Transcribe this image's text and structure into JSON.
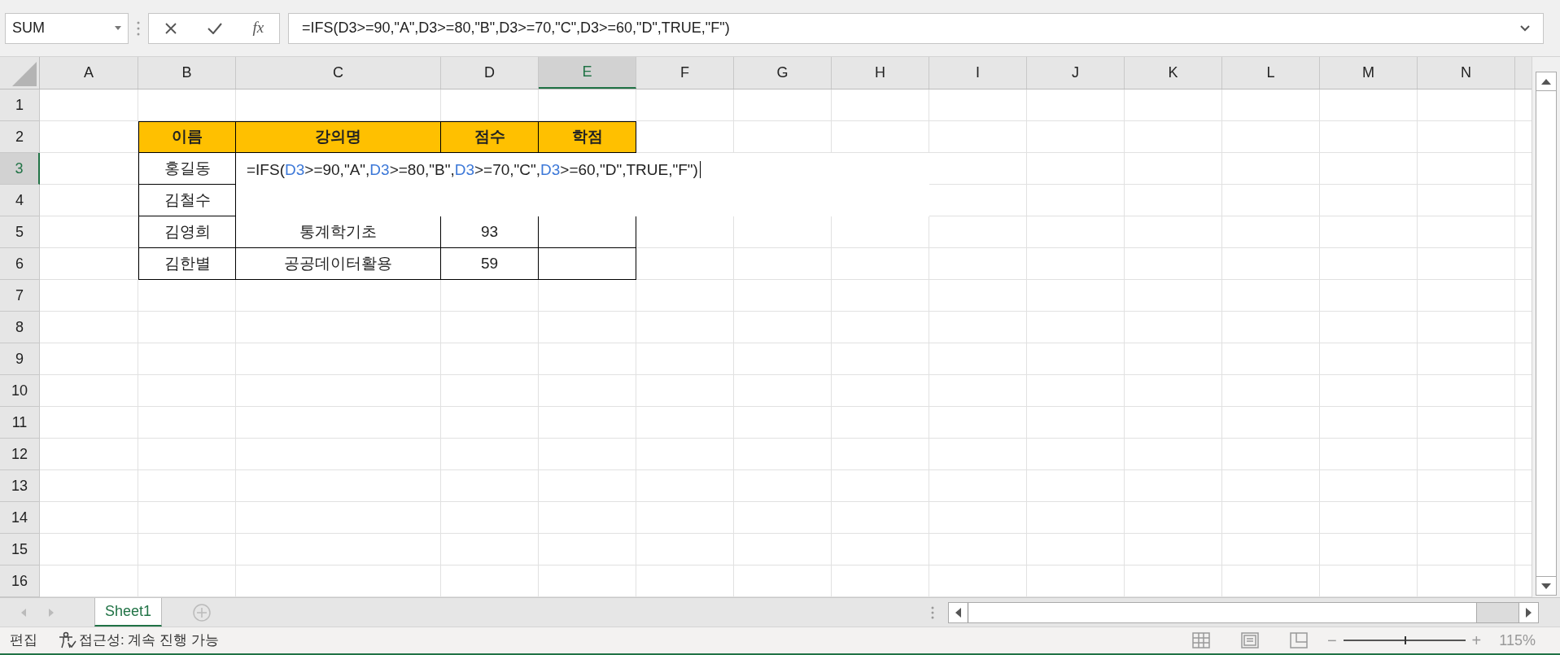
{
  "name_box": {
    "value": "SUM"
  },
  "formula_bar": {
    "fx_label": "fx",
    "value": "=IFS(D3>=90,\"A\",D3>=80,\"B\",D3>=70,\"C\",D3>=60,\"D\",TRUE,\"F\")"
  },
  "columns": [
    {
      "label": "A",
      "selected": false
    },
    {
      "label": "B",
      "selected": false
    },
    {
      "label": "C",
      "selected": false
    },
    {
      "label": "D",
      "selected": false
    },
    {
      "label": "E",
      "selected": true
    },
    {
      "label": "F",
      "selected": false
    },
    {
      "label": "G",
      "selected": false
    },
    {
      "label": "H",
      "selected": false
    },
    {
      "label": "I",
      "selected": false
    },
    {
      "label": "J",
      "selected": false
    },
    {
      "label": "K",
      "selected": false
    },
    {
      "label": "L",
      "selected": false
    },
    {
      "label": "M",
      "selected": false
    },
    {
      "label": "N",
      "selected": false
    }
  ],
  "rows": [
    {
      "label": "1",
      "selected": false
    },
    {
      "label": "2",
      "selected": false
    },
    {
      "label": "3",
      "selected": true
    },
    {
      "label": "4",
      "selected": false
    },
    {
      "label": "5",
      "selected": false
    },
    {
      "label": "6",
      "selected": false
    },
    {
      "label": "7",
      "selected": false
    },
    {
      "label": "8",
      "selected": false
    },
    {
      "label": "9",
      "selected": false
    },
    {
      "label": "10",
      "selected": false
    },
    {
      "label": "11",
      "selected": false
    },
    {
      "label": "12",
      "selected": false
    },
    {
      "label": "13",
      "selected": false
    },
    {
      "label": "14",
      "selected": false
    },
    {
      "label": "15",
      "selected": false
    },
    {
      "label": "16",
      "selected": false
    }
  ],
  "table": {
    "header": [
      "이름",
      "강의명",
      "점수",
      "학점"
    ],
    "rows": [
      [
        "홍길동"
      ],
      [
        "김철수"
      ],
      [
        "김영희",
        "통계학기초",
        "93"
      ],
      [
        "김한별",
        "공공데이터활용",
        "59"
      ]
    ]
  },
  "cell_editor": {
    "segments": [
      {
        "kind": "plain",
        "text": "=IFS("
      },
      {
        "kind": "ref",
        "text": "D3"
      },
      {
        "kind": "plain",
        "text": ">=90,\"A\","
      },
      {
        "kind": "ref",
        "text": "D3"
      },
      {
        "kind": "plain",
        "text": ">=80,\"B\","
      },
      {
        "kind": "ref",
        "text": "D3"
      },
      {
        "kind": "plain",
        "text": ">=70,\"C\","
      },
      {
        "kind": "ref",
        "text": "D3"
      },
      {
        "kind": "plain",
        "text": ">=60,\"D\",TRUE,\"F\")"
      }
    ]
  },
  "sheet_tabs": [
    {
      "label": "Sheet1",
      "selected": true
    }
  ],
  "status_bar": {
    "mode": "편집",
    "accessibility": "접근성: 계속 진행 가능",
    "zoom": {
      "minus": "−",
      "plus": "+",
      "level": 0.5,
      "reading": "115%"
    }
  }
}
